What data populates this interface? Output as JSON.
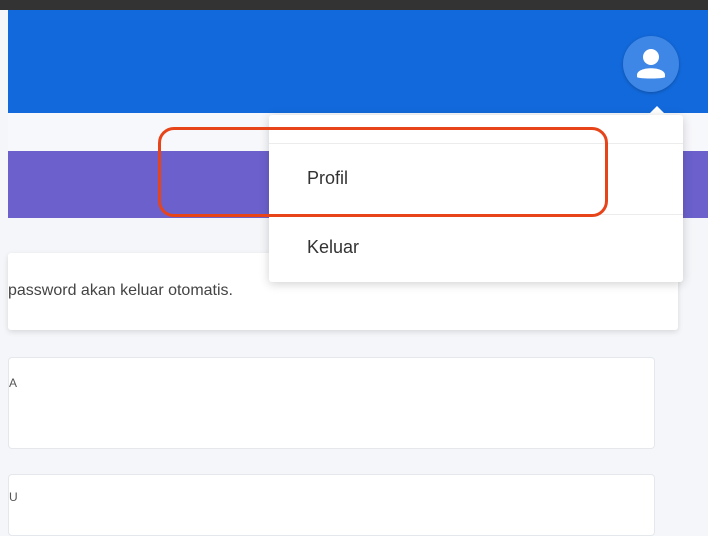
{
  "header": {
    "avatar_icon": "user-avatar-icon",
    "accent_color": "#1269db"
  },
  "banner": {
    "color": "#6b60cc"
  },
  "alert": {
    "text": "password akan keluar otomatis."
  },
  "form": {
    "fields": [
      {
        "label": "A"
      },
      {
        "label": "U"
      }
    ]
  },
  "user_menu": {
    "items": [
      {
        "label": "Profil"
      },
      {
        "label": "Keluar"
      }
    ]
  },
  "annotation": {
    "color": "#e8441a"
  }
}
